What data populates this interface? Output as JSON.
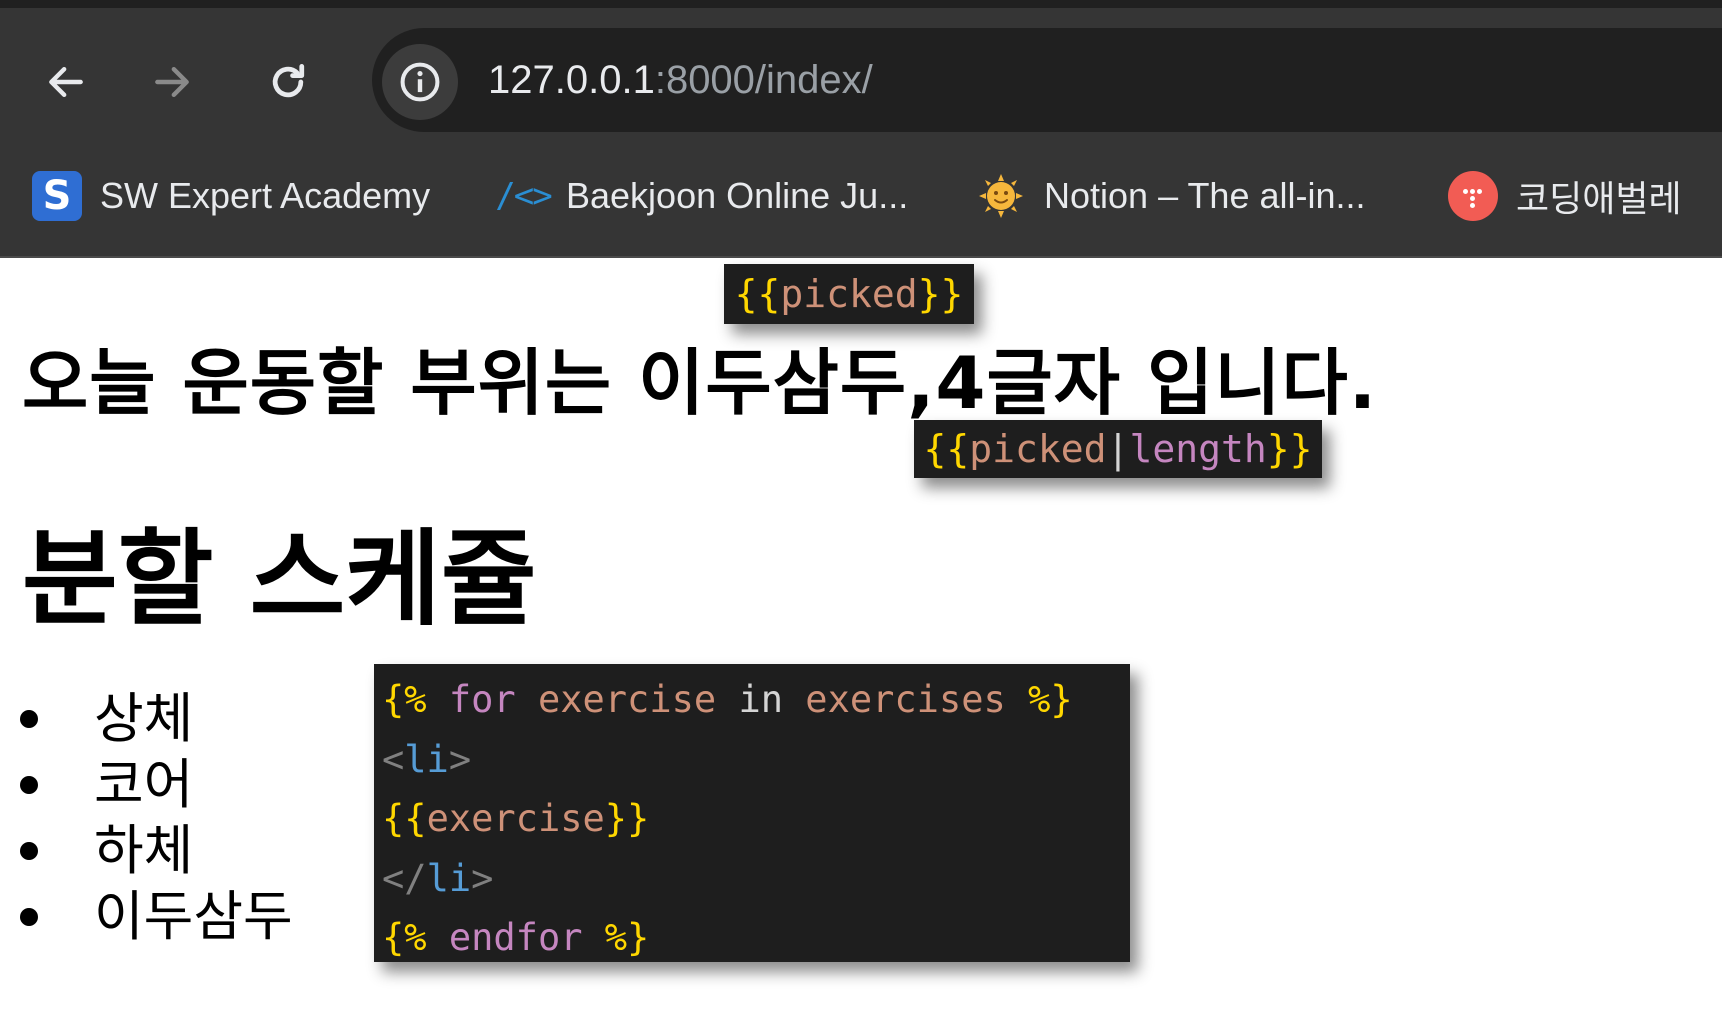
{
  "browser": {
    "url_host": "127.0.0.1",
    "url_rest": ":8000/index/",
    "bookmarks": [
      {
        "label": "SW Expert Academy",
        "icon": "swea-s-icon",
        "icon_glyph": "S"
      },
      {
        "label": "Baekjoon Online Ju...",
        "icon": "baekjoon-code-icon",
        "icon_glyph": "/<>"
      },
      {
        "label": "Notion – The all-in...",
        "icon": "sun-face-icon"
      },
      {
        "label": "코딩애벌레",
        "icon": "coding-larva-icon"
      }
    ]
  },
  "page": {
    "heading": "오늘 운동할 부위는 이두삼두,4글자 입니다.",
    "schedule_title": "분할 스케쥴",
    "exercises": [
      "상체",
      "코어",
      "하체",
      "이두삼두"
    ]
  },
  "annotations": {
    "picked": {
      "open": "{{",
      "var": "picked",
      "close": "}}"
    },
    "picked_length": {
      "open": "{{",
      "var": "picked",
      "pipe": "|",
      "filter": "length",
      "close": "}}"
    },
    "for_loop": {
      "line1": {
        "open": "{%",
        "kw": "for",
        "var1": "exercise",
        "in": "in",
        "var2": "exercises",
        "close": "%}"
      },
      "line2": {
        "lt": "<",
        "tag": "li",
        "gt": ">"
      },
      "line3": {
        "open": "{{",
        "var": "exercise",
        "close": "}}"
      },
      "line4": {
        "lt": "</",
        "tag": "li",
        "gt": ">"
      },
      "line5": {
        "open": "{%",
        "kw": "endfor",
        "close": "%}"
      }
    }
  },
  "colors": {
    "chrome_bg": "#353535",
    "omnibox_bg": "#202020",
    "code_bg": "#1e1e1e",
    "brace_yellow": "#ffd700",
    "variable_orange": "#ce9178",
    "keyword_purple": "#c586c0",
    "tag_blue": "#569cd6"
  }
}
